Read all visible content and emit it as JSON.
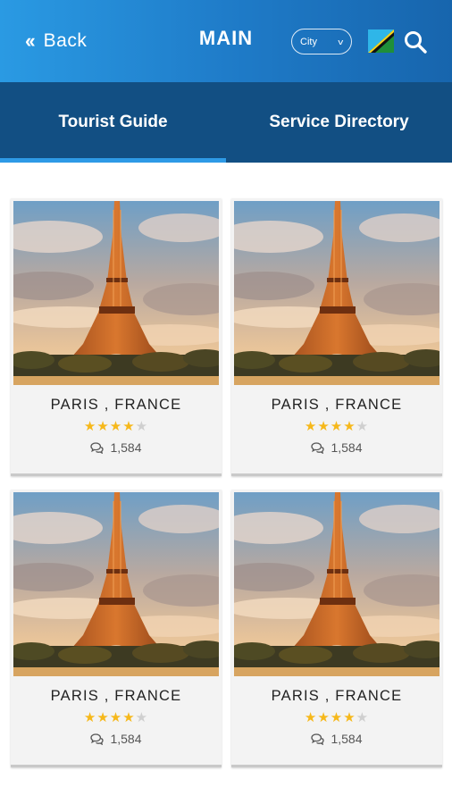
{
  "header": {
    "back_label": "Back",
    "title": "MAIN",
    "city_select": {
      "selected": "City"
    },
    "flag_icon": "flag-icon",
    "search_icon": "search-icon"
  },
  "tabs": [
    {
      "label": "Tourist Guide",
      "active": true
    },
    {
      "label": "Service Directory",
      "active": false
    }
  ],
  "colors": {
    "header_gradient": [
      "#2a9ae3",
      "#1765ad"
    ],
    "tab_bar": "#124f83",
    "tab_indicator": "#2e9ae6",
    "star_on": "#f6b81a",
    "star_off": "#cfcfcf"
  },
  "cards": [
    {
      "name": "PARIS , FRANCE",
      "rating": 4,
      "max_rating": 5,
      "reviews": "1,584"
    },
    {
      "name": "PARIS , FRANCE",
      "rating": 4,
      "max_rating": 5,
      "reviews": "1,584"
    },
    {
      "name": "PARIS , FRANCE",
      "rating": 4,
      "max_rating": 5,
      "reviews": "1,584"
    },
    {
      "name": "PARIS , FRANCE",
      "rating": 4,
      "max_rating": 5,
      "reviews": "1,584"
    }
  ]
}
